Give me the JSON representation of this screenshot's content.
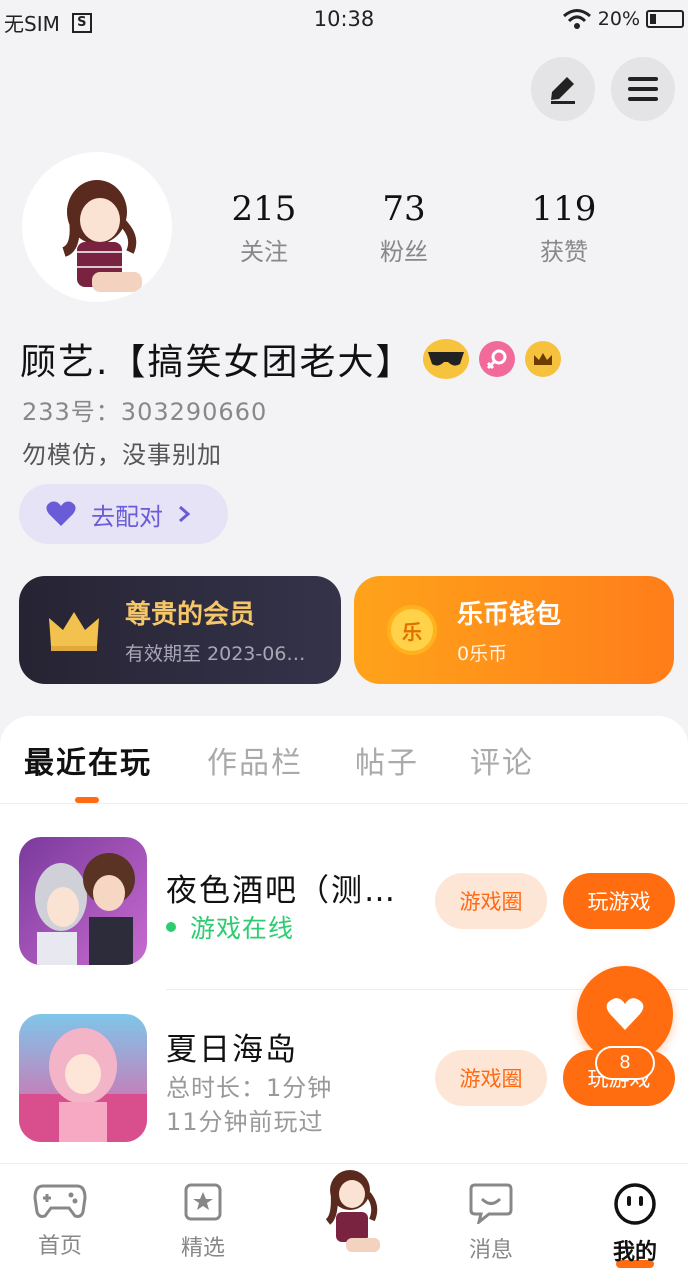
{
  "status_bar": {
    "carrier": "无SIM",
    "sim_icon": "S",
    "time": "10:38",
    "battery_text": "20%",
    "battery_level": 0.2
  },
  "toolbar": {
    "edit_icon": "pen-icon",
    "menu_icon": "hamburger-icon"
  },
  "profile": {
    "stats": [
      {
        "value": "215",
        "label": "关注"
      },
      {
        "value": "73",
        "label": "粉丝"
      },
      {
        "value": "119",
        "label": "获赞"
      }
    ],
    "username": "顾艺.【搞笑女团老大】",
    "uid": "233号：303290660",
    "bio": "勿模仿，没事别加",
    "pair_button": "去配对"
  },
  "cards": {
    "vip": {
      "title": "尊贵的会员",
      "subtitle": "有效期至 2023-06…"
    },
    "wallet": {
      "title": "乐币钱包",
      "subtitle": "0乐币",
      "coin_glyph": "乐"
    }
  },
  "tabs": [
    "最近在玩",
    "作品栏",
    "帖子",
    "评论"
  ],
  "games": [
    {
      "title": "夜色酒吧（测…",
      "status": "游戏在线",
      "circle_btn": "游戏圈",
      "play_btn": "玩游戏"
    },
    {
      "title": "夏日海岛",
      "total_time": "总时长：1分钟",
      "last_played": "11分钟前玩过",
      "circle_btn": "游戏圈",
      "play_btn": "玩游戏"
    }
  ],
  "favorite": {
    "count": "8"
  },
  "bottom_nav": [
    "首页",
    "精选",
    "消息",
    "我的"
  ],
  "colors": {
    "accent": "#ff6d10",
    "online": "#2ecc71",
    "pair": "#6a5bd6"
  }
}
